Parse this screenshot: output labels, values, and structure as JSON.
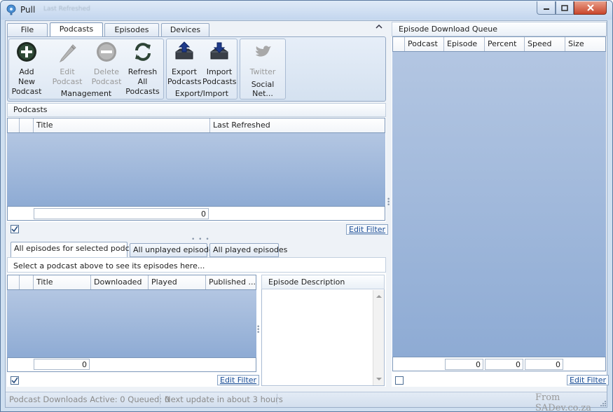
{
  "window": {
    "title": "Pull",
    "title_extra": "Last Refreshed"
  },
  "ribbon": {
    "tabs": [
      {
        "label": "File"
      },
      {
        "label": "Podcasts"
      },
      {
        "label": "Episodes"
      },
      {
        "label": "Devices"
      }
    ],
    "groups": {
      "management": {
        "label": "Management",
        "buttons": [
          {
            "label1": "Add New",
            "label2": "Podcast"
          },
          {
            "label1": "Edit Podcast",
            "label2": ""
          },
          {
            "label1": "Delete",
            "label2": "Podcast"
          },
          {
            "label1": "Refresh All",
            "label2": "Podcasts"
          }
        ]
      },
      "export_import": {
        "label": "Export/Import",
        "buttons": [
          {
            "label1": "Export",
            "label2": "Podcasts"
          },
          {
            "label1": "Import",
            "label2": "Podcasts"
          }
        ]
      },
      "social": {
        "label": "Social Net...",
        "buttons": [
          {
            "label1": "Twitter",
            "label2": ""
          }
        ]
      }
    }
  },
  "podcasts": {
    "section_title": "Podcasts",
    "columns": [
      "Title",
      "Last Refreshed"
    ],
    "count": "0",
    "edit_filter": "Edit Filter"
  },
  "episodes": {
    "tabs": [
      "All episodes for selected podcast",
      "All unplayed episodes",
      "All played episodes"
    ],
    "hint": "Select a podcast above to see its episodes here...",
    "columns": [
      "Title",
      "Downloaded",
      "Played",
      "Published ..."
    ],
    "count": "0",
    "edit_filter": "Edit Filter",
    "description_title": "Episode Description"
  },
  "queue": {
    "section_title": "Episode Download Queue",
    "columns": [
      "Podcast",
      "Episode",
      "Percent",
      "Speed",
      "Size"
    ],
    "totals": [
      "0",
      "0",
      "0"
    ],
    "edit_filter": "Edit Filter"
  },
  "status": {
    "downloads": "Podcast Downloads Active: 0 Queued: 0",
    "next_update": "Next update in about 3 hours",
    "watermark": "From SADev.co.za"
  },
  "colors": {
    "accent": "#3b6aa8",
    "grid_body": "#a3b9dc"
  }
}
